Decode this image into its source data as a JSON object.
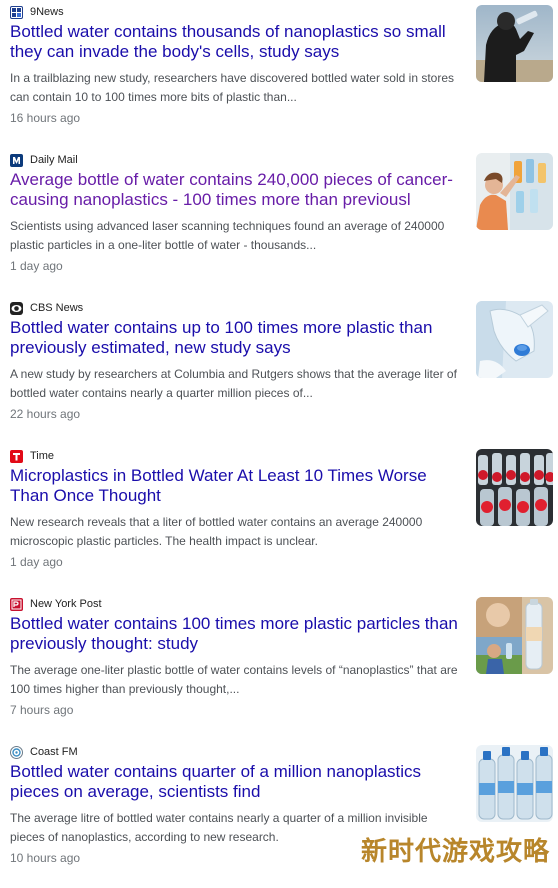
{
  "articles": [
    {
      "source": "9News",
      "source_icon": "9news-logo-icon",
      "headline": "Bottled water contains thousands of nanoplastics so small they can invade the body's cells, study says",
      "snippet": "In a trailblazing new study, researchers have discovered bottled water sold in stores can contain 10 to 100 times more bits of plastic than...",
      "time": "16 hours ago",
      "visited": false
    },
    {
      "source": "Daily Mail",
      "source_icon": "daily-mail-logo-icon",
      "headline": "Average bottle of water contains 240,000 pieces of cancer-causing nanoplastics - 100 times more than previousl",
      "snippet": "Scientists using advanced laser scanning techniques found an average of 240000 plastic particles in a one-liter bottle of water - thousands...",
      "time": "1 day ago",
      "visited": true
    },
    {
      "source": "CBS News",
      "source_icon": "cbs-news-logo-icon",
      "headline": "Bottled water contains up to 100 times more plastic than previously estimated, new study says",
      "snippet": "A new study by researchers at Columbia and Rutgers shows that the average liter of bottled water contains nearly a quarter million pieces of...",
      "time": "22 hours ago",
      "visited": false
    },
    {
      "source": "Time",
      "source_icon": "time-logo-icon",
      "headline": "Microplastics in Bottled Water At Least 10 Times Worse Than Once Thought",
      "snippet": "New research reveals that a liter of bottled water contains an average 240000 microscopic plastic particles. The health impact is unclear.",
      "time": "1 day ago",
      "visited": false
    },
    {
      "source": "New York Post",
      "source_icon": "new-york-post-logo-icon",
      "headline": "Bottled water contains 100 times more plastic particles than previously thought: study",
      "snippet": "The average one-liter plastic bottle of water contains levels of “nanoplastics” that are 100 times higher than previously thought,...",
      "time": "7 hours ago",
      "visited": false
    },
    {
      "source": "Coast FM",
      "source_icon": "coast-fm-logo-icon",
      "headline": "Bottled water contains quarter of a million nanoplastics pieces on average, scientists find",
      "snippet": "The average litre of bottled water contains nearly a quarter of a million invisible pieces of nanoplastics, according to new research.",
      "time": "10 hours ago",
      "visited": false
    }
  ],
  "watermark": "新时代游戏攻略",
  "colors": {
    "headline": "#1a0dab",
    "headline_visited": "#681da8",
    "snippet": "#4d5156",
    "time": "#70757a"
  }
}
